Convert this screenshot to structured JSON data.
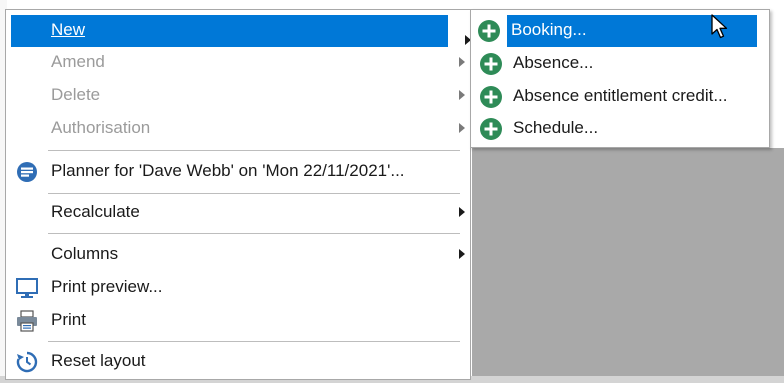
{
  "menu": {
    "items": [
      {
        "label": "New",
        "state": "selected",
        "has_submenu": true
      },
      {
        "label": "Amend",
        "state": "disabled",
        "has_submenu": true
      },
      {
        "label": "Delete",
        "state": "disabled",
        "has_submenu": true
      },
      {
        "label": "Authorisation",
        "state": "disabled",
        "has_submenu": true
      },
      {
        "label": "Planner for 'Dave Webb' on 'Mon 22/11/2021'...",
        "icon": "planner-icon"
      },
      {
        "label": "Recalculate",
        "has_submenu": true
      },
      {
        "label": "Columns",
        "has_submenu": true
      },
      {
        "label": "Print preview...",
        "icon": "monitor-icon"
      },
      {
        "label": "Print",
        "icon": "printer-icon"
      },
      {
        "label": "Reset layout",
        "icon": "history-icon"
      }
    ]
  },
  "submenu": {
    "items": [
      {
        "label": "Booking...",
        "icon": "plus-circle-icon",
        "state": "selected"
      },
      {
        "label": "Absence...",
        "icon": "plus-circle-icon"
      },
      {
        "label": "Absence entitlement credit...",
        "icon": "plus-circle-icon"
      },
      {
        "label": "Schedule...",
        "icon": "plus-circle-icon"
      }
    ]
  },
  "colors": {
    "selection": "#0078d7",
    "disabled_text": "#9b9b9b",
    "plus_icon": "#2e8b57",
    "planner_icon": "#2f6db5"
  }
}
